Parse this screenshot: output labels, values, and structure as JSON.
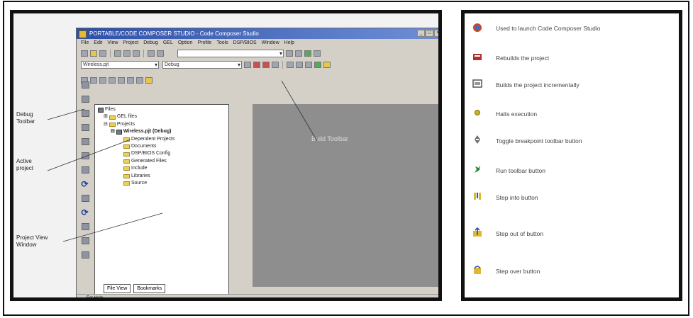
{
  "ide": {
    "title": "PORTABLE/CODE COMPOSER STUDIO - Code Composer Studio",
    "menu": [
      "File",
      "Edit",
      "View",
      "Project",
      "Debug",
      "GEL",
      "Option",
      "Profile",
      "Tools",
      "DSP/BIOS",
      "Window",
      "Help"
    ],
    "project_combo": "Wireless.pjt",
    "config_combo": "Debug",
    "tree": {
      "root": "Files",
      "gel_files": "GEL files",
      "projects": "Projects",
      "active_project": "Wireless.pjt (Debug)",
      "folders": [
        "Dependent Projects",
        "Documents",
        "DSP/BIOS Config",
        "Generated Files",
        "Include",
        "Libraries",
        "Source"
      ]
    },
    "tabs": {
      "file_view": "File View",
      "bookmarks": "Bookmarks"
    },
    "status": "For Help"
  },
  "callouts": {
    "debug_toolbar": "Debug\nToolbar",
    "active_project": "Active\nproject",
    "project_view": "Project View\nWindow",
    "build_toolbar": "Build Toolbar"
  },
  "legend": [
    {
      "icon": "ccs-launch-icon",
      "text": "Used to launch Code Composer Studio",
      "color": "#c2492f"
    },
    {
      "icon": "rebuild-icon",
      "text": "Rebuilds the project",
      "color": "#b03030"
    },
    {
      "icon": "build-incremental-icon",
      "text": "Builds the project incrementally",
      "color": "#555555"
    },
    {
      "icon": "halt-icon",
      "text": "Halts execution",
      "color": "#c8b41e"
    },
    {
      "icon": "toggle-breakpoint-icon",
      "text": "Toggle breakpoint toolbar button",
      "color": "#6a6a6a"
    },
    {
      "icon": "run-icon",
      "text": "Run toolbar button",
      "color": "#2a8a3a"
    },
    {
      "icon": "step-into-icon",
      "text": "Step into button",
      "color": "#2a4fb0"
    },
    {
      "icon": "step-out-icon",
      "text": "Step out of button",
      "color": "#2a4fb0"
    },
    {
      "icon": "step-over-icon",
      "text": "Step over button",
      "color": "#2a4fb0"
    }
  ]
}
